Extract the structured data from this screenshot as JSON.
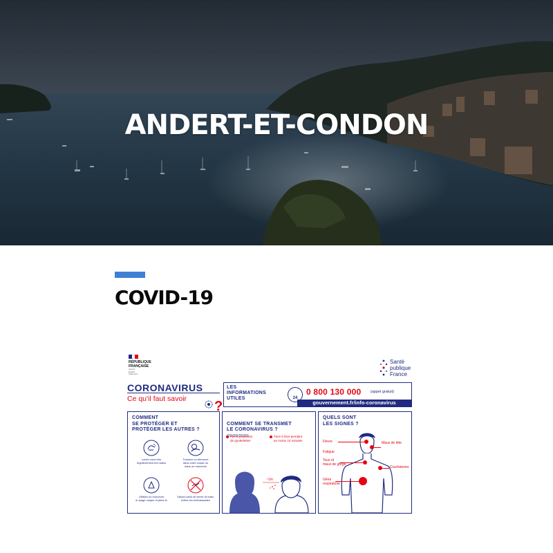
{
  "hero": {
    "title": "ANDERT-ET-CONDON"
  },
  "section": {
    "title": "COVID-19",
    "accent_color": "#3f7fd4"
  },
  "infographic": {
    "republique": "RÉPUBLIQUE\nFRANÇAISE",
    "motto": "Liberté\nÉgalité\nFraternité",
    "sante_publique": "Santé\npublique\nFrance",
    "title": "CORONAVIRUS",
    "subtitle": "Ce qu'il faut savoir",
    "info_label": "LES\nINFORMATIONS\nUTILES",
    "hotline_badge": "24",
    "phone": "0 800 130 000",
    "phone_note": "(appel gratuit)",
    "url": "gouvernement.fr/info-coronavirus",
    "panels": {
      "protect": {
        "title": "COMMENT\nSE PROTÉGER ET\nPROTÉGER LES AUTRES ?",
        "tips": [
          "Lavez-vous très\nrégulièrement les mains",
          "Toussez ou éternuez\ndans votre coude ou\ndans un mouchoir",
          "Utilisez un mouchoir\nà usage unique et jetez-le",
          "Saluez sans se serrer la main,\névitez les embrassades"
        ]
      },
      "transmit": {
        "title": "COMMENT SE TRANSMET\nLE CORONAVIRUS ?",
        "date": "(09/03/2020)",
        "point_1": "Par la projection\nde gouttelettes",
        "point_2": "Face à face pendant\nau moins 15 minutes",
        "distance": "~1m"
      },
      "signs": {
        "title": "QUELS SONT\nLES SIGNES ?",
        "fievre": "Fièvre",
        "maux_de_tete": "Maux de tête",
        "fatigue": "Fatigue",
        "toux": "Toux et\nmaux de gorge",
        "courbatures": "Courbatures",
        "gene": "Gêne\nrespiratoire"
      }
    }
  }
}
